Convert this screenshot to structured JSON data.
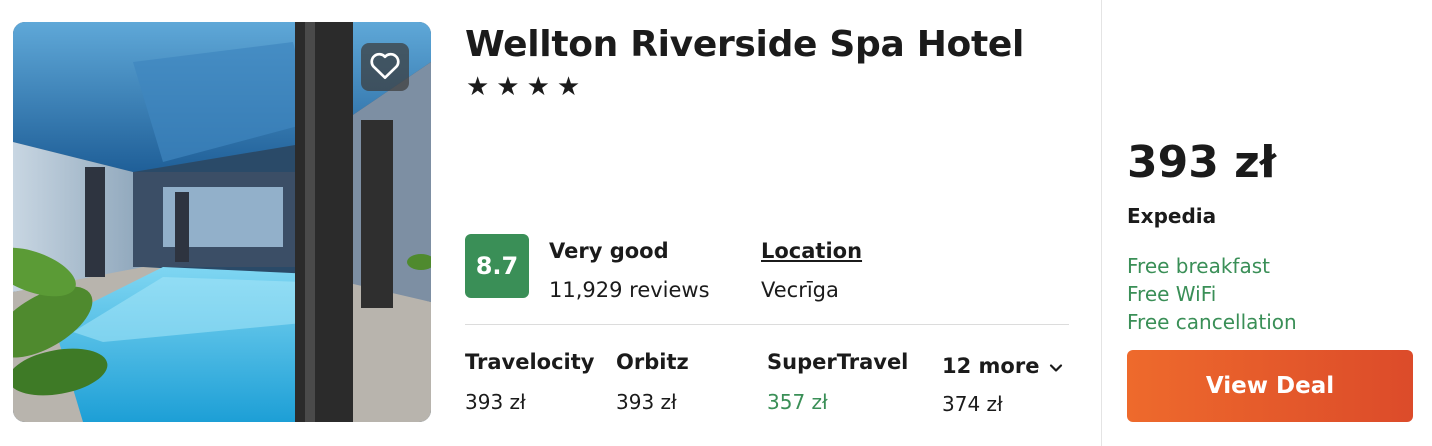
{
  "hotel": {
    "name": "Wellton Riverside Spa Hotel",
    "stars": "★★★★",
    "star_count": 4
  },
  "rating": {
    "score": "8.7",
    "label": "Very good",
    "reviews": "11,929 reviews"
  },
  "location": {
    "label": "Location",
    "value": "Vecrīga"
  },
  "providers": [
    {
      "name": "Travelocity",
      "price": "393 zł",
      "highlight": false
    },
    {
      "name": "Orbitz",
      "price": "393 zł",
      "highlight": false
    },
    {
      "name": "SuperTravel",
      "price": "357 zł",
      "highlight": true
    }
  ],
  "more": {
    "label": "12 more",
    "price": "374 zł",
    "icon": "chevron-down-icon"
  },
  "deal": {
    "price": "393 zł",
    "provider": "Expedia",
    "amenities": [
      "Free breakfast",
      "Free WiFi",
      "Free cancellation"
    ],
    "button_label": "View Deal"
  },
  "icons": {
    "favorite": "heart-outline-icon"
  },
  "colors": {
    "rating_green": "#3a8f57",
    "button_orange": "#e85d2b",
    "text_dark": "#1b1b1b"
  }
}
